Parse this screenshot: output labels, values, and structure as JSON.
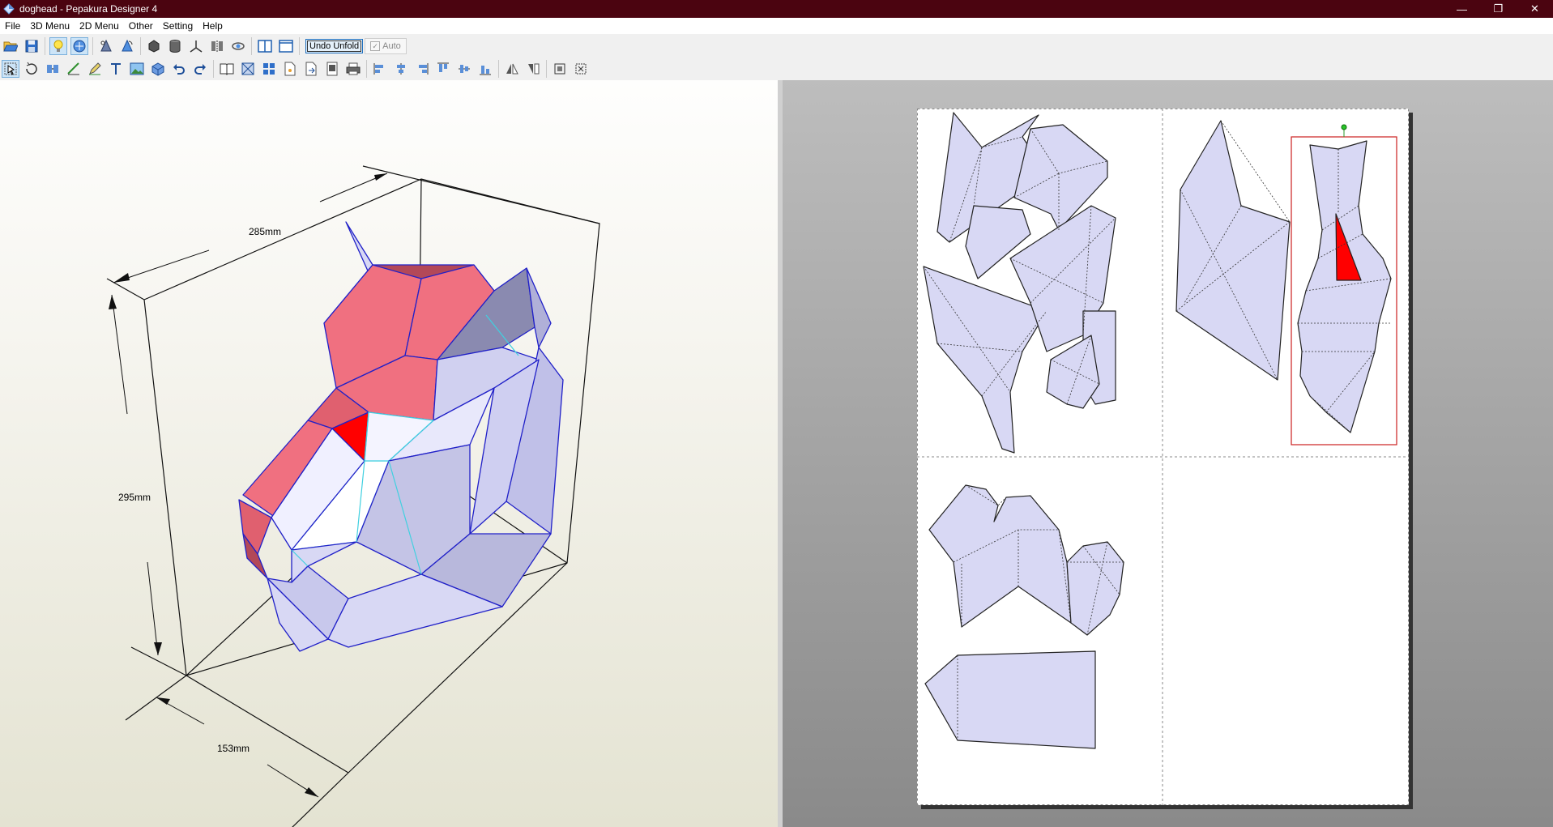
{
  "window": {
    "title": "doghead - Pepakura Designer 4",
    "controls": {
      "minimize": "—",
      "maximize": "❐",
      "close": "✕"
    }
  },
  "menu": [
    "File",
    "3D Menu",
    "2D Menu",
    "Other",
    "Setting",
    "Help"
  ],
  "toolbar1": {
    "undo_unfold_label": "Undo Unfold",
    "auto_label": "Auto",
    "auto_checked": true,
    "buttons": [
      "open-file",
      "save-file",
      "light",
      "texture-toggle",
      "rotate-part",
      "rotate-part-alt",
      "cylinder-a",
      "cylinder-b",
      "axis",
      "split-view",
      "rotate-3d",
      "view-split",
      "view-single"
    ]
  },
  "toolbar2": {
    "buttons": [
      "select-tool",
      "rotate-tool",
      "join-edge",
      "edit-fold",
      "pen-tool",
      "text-tool",
      "image-tool",
      "3d-object",
      "undo",
      "redo",
      "book-layout",
      "unfold-auto",
      "tile",
      "page-settings",
      "export-page",
      "print-preview",
      "print",
      "align-left",
      "align-center",
      "align-right",
      "align-top",
      "align-middle",
      "align-bottom",
      "flip-h",
      "flip-v",
      "fit-all",
      "fit-selection"
    ]
  },
  "view3d": {
    "dimensions": {
      "width": "285mm",
      "height": "295mm",
      "depth": "153mm"
    }
  },
  "colors": {
    "titlebar": "#4b0410",
    "face_light": "#d8d8f4",
    "face_red": "#f07080",
    "face_selected": "#ff0000",
    "edge_blue": "#2020c8",
    "edge_cyan": "#40d0e0",
    "selection_box": "#cc2020"
  }
}
